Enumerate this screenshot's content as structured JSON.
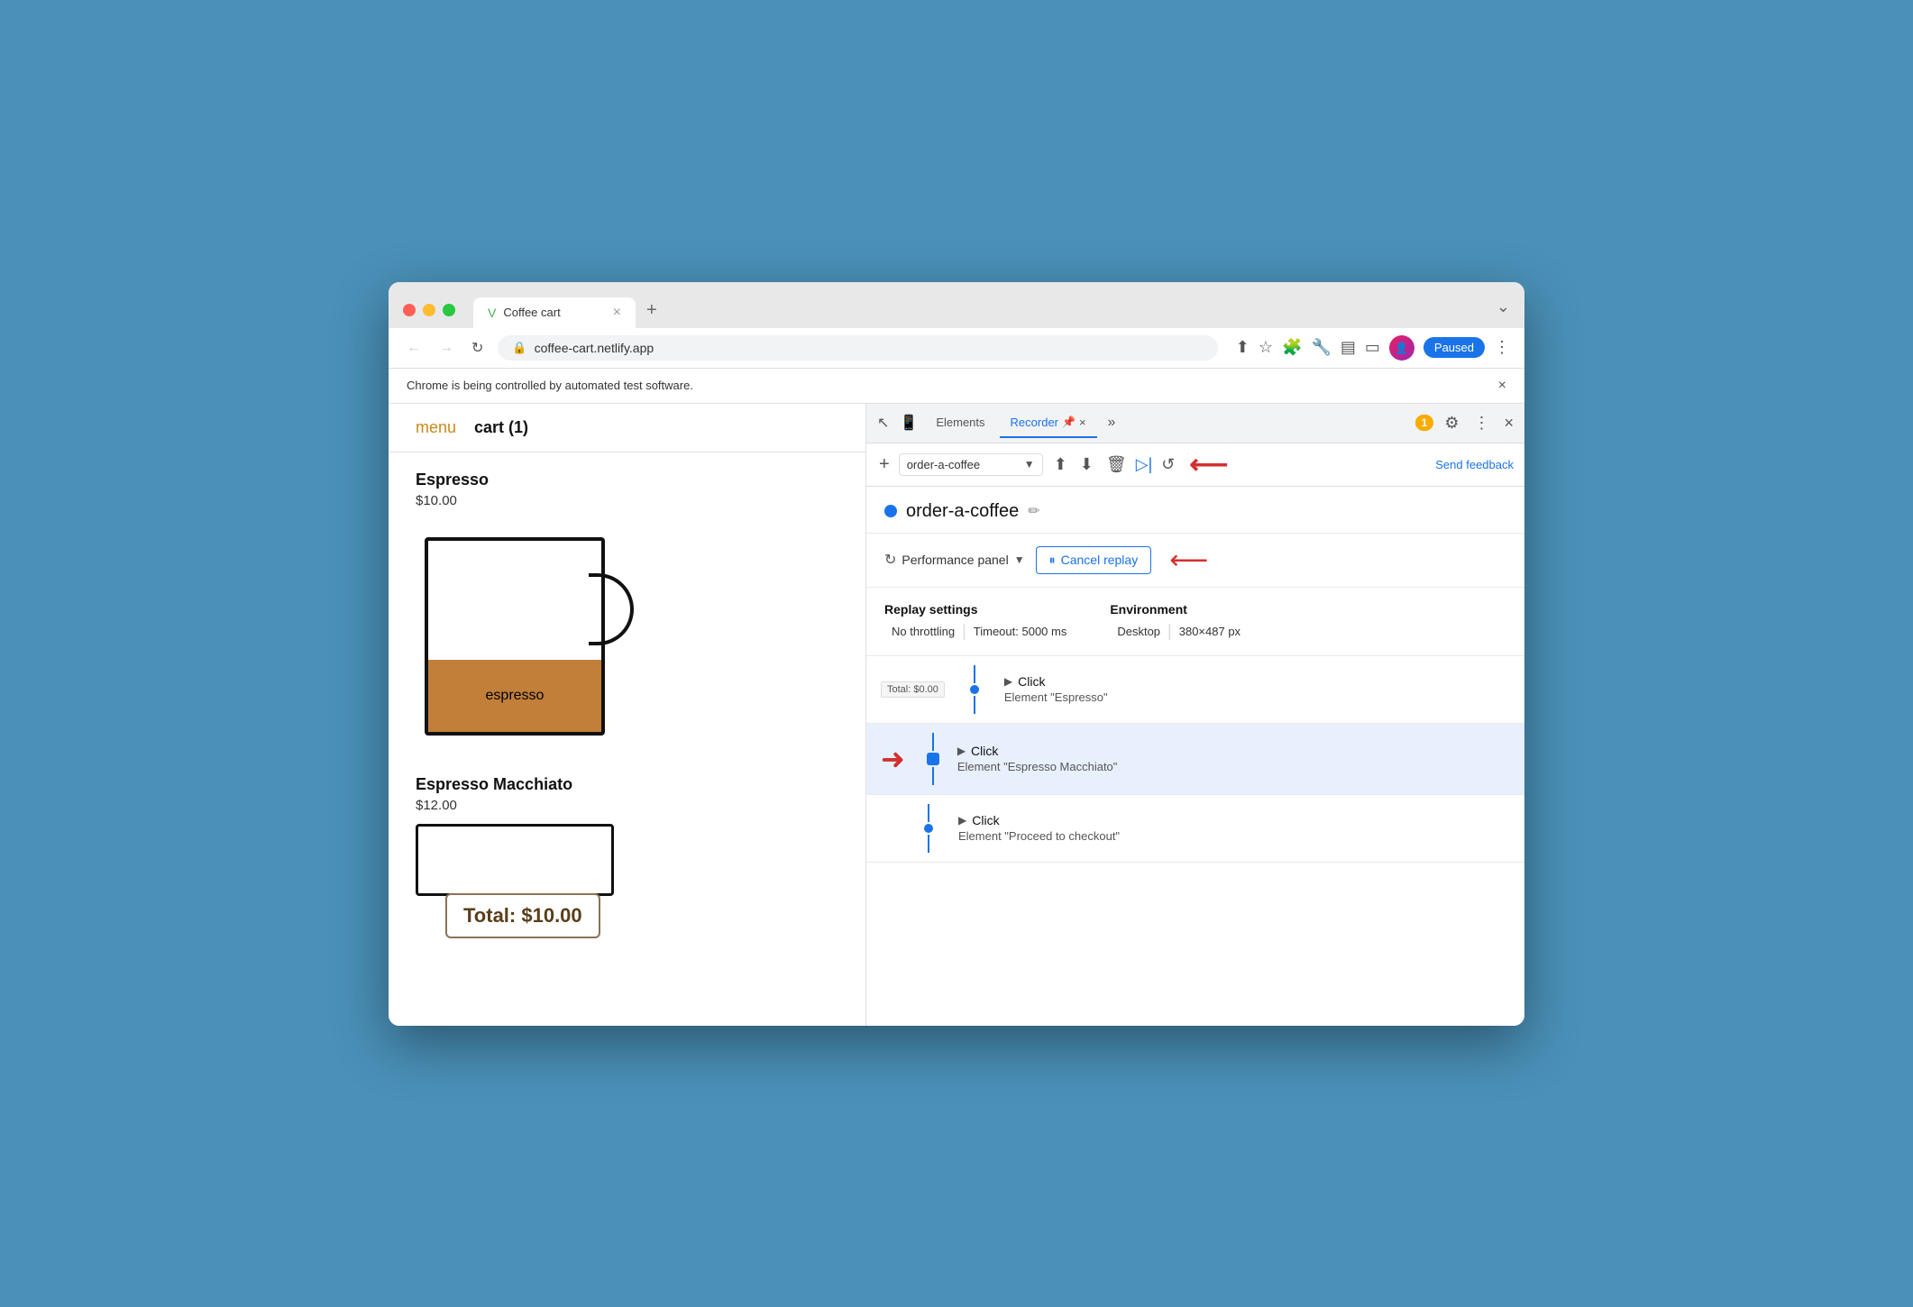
{
  "browser": {
    "tab_title": "Coffee cart",
    "tab_favicon": "V",
    "url": "coffee-cart.netlify.app",
    "paused_label": "Paused",
    "new_tab_label": "+",
    "automation_banner": "Chrome is being controlled by automated test software.",
    "close_banner": "×"
  },
  "app": {
    "nav_menu": "menu",
    "nav_cart": "cart (1)",
    "products": [
      {
        "name": "Espresso",
        "price": "$10.00",
        "fill_label": "espresso",
        "has_mug": true
      },
      {
        "name": "Espresso Macchiato",
        "price": "$12.00",
        "has_mug": true
      }
    ],
    "total_label": "Total: $10.00"
  },
  "devtools": {
    "tabs": [
      {
        "label": "Elements",
        "active": false
      },
      {
        "label": "Recorder",
        "active": true
      },
      {
        "label": "📌",
        "active": false
      }
    ],
    "tabs_more": "»",
    "badge_count": "1",
    "recording_name": "order-a-coffee",
    "toolbar": {
      "add_icon": "+",
      "recording_select": "order-a-coffee",
      "icons": [
        "⬆",
        "⬇",
        "🗑",
        "▷|",
        "↺"
      ],
      "send_feedback": "Send feedback"
    },
    "performance_label": "Performance panel",
    "cancel_replay_label": "Cancel replay",
    "settings": {
      "replay_label": "Replay settings",
      "throttling": "No throttling",
      "timeout": "Timeout: 5000 ms",
      "environment_label": "Environment",
      "desktop": "Desktop",
      "resolution": "380×487 px"
    },
    "steps": [
      {
        "action": "Click",
        "detail": "Element \"Espresso\"",
        "active": false,
        "preview": "Total: $0.00"
      },
      {
        "action": "Click",
        "detail": "Element \"Espresso Macchiato\"",
        "active": true,
        "preview": null
      },
      {
        "action": "Click",
        "detail": "Element \"Proceed to checkout\"",
        "active": false,
        "preview": null
      }
    ]
  }
}
